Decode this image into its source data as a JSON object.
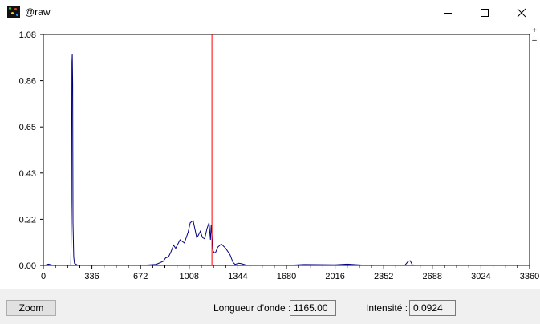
{
  "window": {
    "title": "@raw"
  },
  "icons": {
    "app": "app-icon",
    "minimize": "minimize-icon",
    "maximize": "maximize-icon",
    "close": "close-icon"
  },
  "zoom_controls": {
    "plus": "+",
    "minus": "–"
  },
  "footer": {
    "zoom_label": "Zoom",
    "wavelength_label": "Longueur d'onde :",
    "wavelength_value": "1165.00",
    "intensity_label": "Intensité :",
    "intensity_value": "0.0924"
  },
  "colors": {
    "series": "#000080",
    "cursor": "#ff0000"
  },
  "chart_data": {
    "type": "line",
    "xlim": [
      0,
      3360
    ],
    "ylim": [
      0,
      1.08
    ],
    "x_ticks": [
      "0",
      "336",
      "672",
      "1008",
      "1344",
      "1680",
      "2016",
      "2352",
      "2688",
      "3024",
      "3360"
    ],
    "y_ticks": [
      "0.00",
      "0.22",
      "0.43",
      "0.65",
      "0.86",
      "1.08"
    ],
    "cursor_x": 1165,
    "series": [
      {
        "x": [
          0,
          20,
          35,
          60,
          120,
          190,
          195,
          198,
          200,
          203,
          205,
          210,
          215,
          240,
          336,
          500,
          672,
          780,
          830,
          840,
          845,
          865,
          880,
          900,
          915,
          945,
          975,
          1000,
          1015,
          1035,
          1060,
          1070,
          1085,
          1100,
          1115,
          1130,
          1140,
          1145,
          1155,
          1160,
          1172,
          1180,
          1190,
          1205,
          1230,
          1260,
          1290,
          1310,
          1325,
          1350,
          1370,
          1400,
          1450,
          1500,
          1680,
          1800,
          2016,
          2100,
          2200,
          2300,
          2350,
          2400,
          2450,
          2500,
          2520,
          2535,
          2550,
          2580,
          3360
        ],
        "y": [
          0.0,
          0.003,
          0.006,
          0.002,
          0.0,
          0.002,
          0.3,
          0.95,
          0.99,
          0.85,
          0.2,
          0.04,
          0.01,
          0.0,
          0.0,
          0.0,
          0.0,
          0.005,
          0.02,
          0.03,
          0.035,
          0.04,
          0.06,
          0.095,
          0.08,
          0.12,
          0.105,
          0.155,
          0.2,
          0.21,
          0.13,
          0.14,
          0.16,
          0.13,
          0.125,
          0.17,
          0.19,
          0.2,
          0.12,
          0.19,
          0.07,
          0.06,
          0.06,
          0.085,
          0.1,
          0.08,
          0.05,
          0.015,
          0.005,
          0.01,
          0.008,
          0.002,
          0.0,
          0.0,
          0.0,
          0.004,
          0.003,
          0.006,
          0.002,
          0.001,
          0.0,
          0.0,
          0.0,
          0.002,
          0.018,
          0.022,
          0.003,
          0.0,
          0.0
        ]
      }
    ]
  }
}
